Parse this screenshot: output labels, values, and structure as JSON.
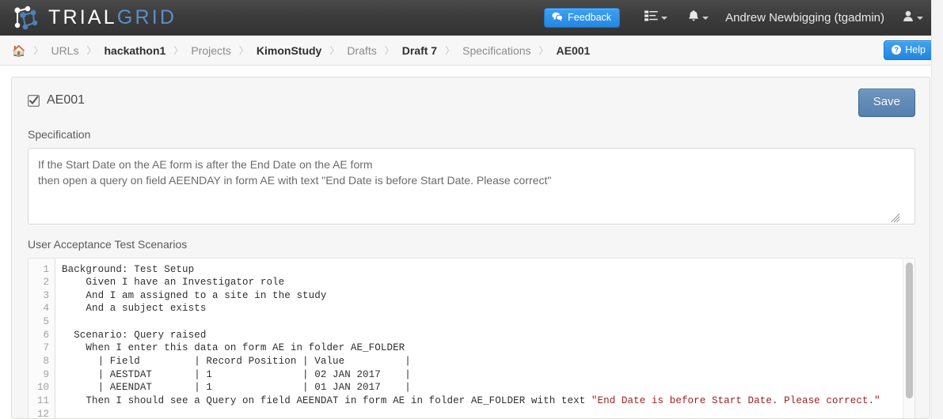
{
  "brand": {
    "text_primary": "TRIAL",
    "text_secondary": "GRID",
    "logo_icon": "node-graph-icon"
  },
  "navbar": {
    "feedback_label": "Feedback",
    "feedback_icon": "comments-icon",
    "tasks_icon": "list-tasks-icon",
    "bell_icon": "bell-icon",
    "username": "Andrew Newbigging (tgadmin)",
    "user_icon": "user-icon",
    "accent_blue": "#2387e3",
    "bar_background": "#3c3c3c"
  },
  "breadcrumb": {
    "home_icon": "home-icon",
    "separator": "〉",
    "items": [
      {
        "label": "URLs",
        "style": "muted"
      },
      {
        "label": "hackathon1",
        "style": "strong"
      },
      {
        "label": "Projects",
        "style": "muted"
      },
      {
        "label": "KimonStudy",
        "style": "strong"
      },
      {
        "label": "Drafts",
        "style": "muted"
      },
      {
        "label": "Draft 7",
        "style": "strong"
      },
      {
        "label": "Specifications",
        "style": "muted"
      },
      {
        "label": "AE001",
        "style": "current"
      }
    ],
    "help_label": "Help",
    "help_icon": "question-circle-icon"
  },
  "panel": {
    "checkbox_icon": "checked-checkbox-icon",
    "checkbox_checked": true,
    "title": "AE001",
    "save_label": "Save",
    "save_color": "#5580ae",
    "specification_label": "Specification",
    "specification_value": "If the Start Date on the AE form is after the End Date on the AE form\nthen open a query on field AEENDAY in form AE with text \"End Date is before Start Date. Please correct\"",
    "specification_placeholder": "",
    "uat_label": "User Acceptance Test Scenarios",
    "resize_grip_icon": "resize-grip-icon"
  },
  "editor": {
    "line_numbers": [
      "1",
      "2",
      "3",
      "4",
      "5",
      "6",
      "7",
      "8",
      "9",
      "10",
      "11",
      "12"
    ],
    "string_color": "#a02020",
    "lines": [
      {
        "text": "Background: Test Setup"
      },
      {
        "text": "    Given I have an Investigator role"
      },
      {
        "text": "    And I am assigned to a site in the study"
      },
      {
        "text": "    And a subject exists"
      },
      {
        "text": ""
      },
      {
        "text": "  Scenario: Query raised"
      },
      {
        "text": "    When I enter this data on form AE in folder AE_FOLDER"
      },
      {
        "text": "      | Field         | Record Position | Value          |"
      },
      {
        "text": "      | AESTDAT       | 1               | 02 JAN 2017    |"
      },
      {
        "text": "      | AEENDAT       | 1               | 01 JAN 2017    |"
      },
      {
        "text": "    Then I should see a Query on field AEENDAT in form AE in folder AE_FOLDER with text ",
        "string": "\"End Date is before Start Date. Please correct.\""
      },
      {
        "text": ""
      }
    ]
  }
}
